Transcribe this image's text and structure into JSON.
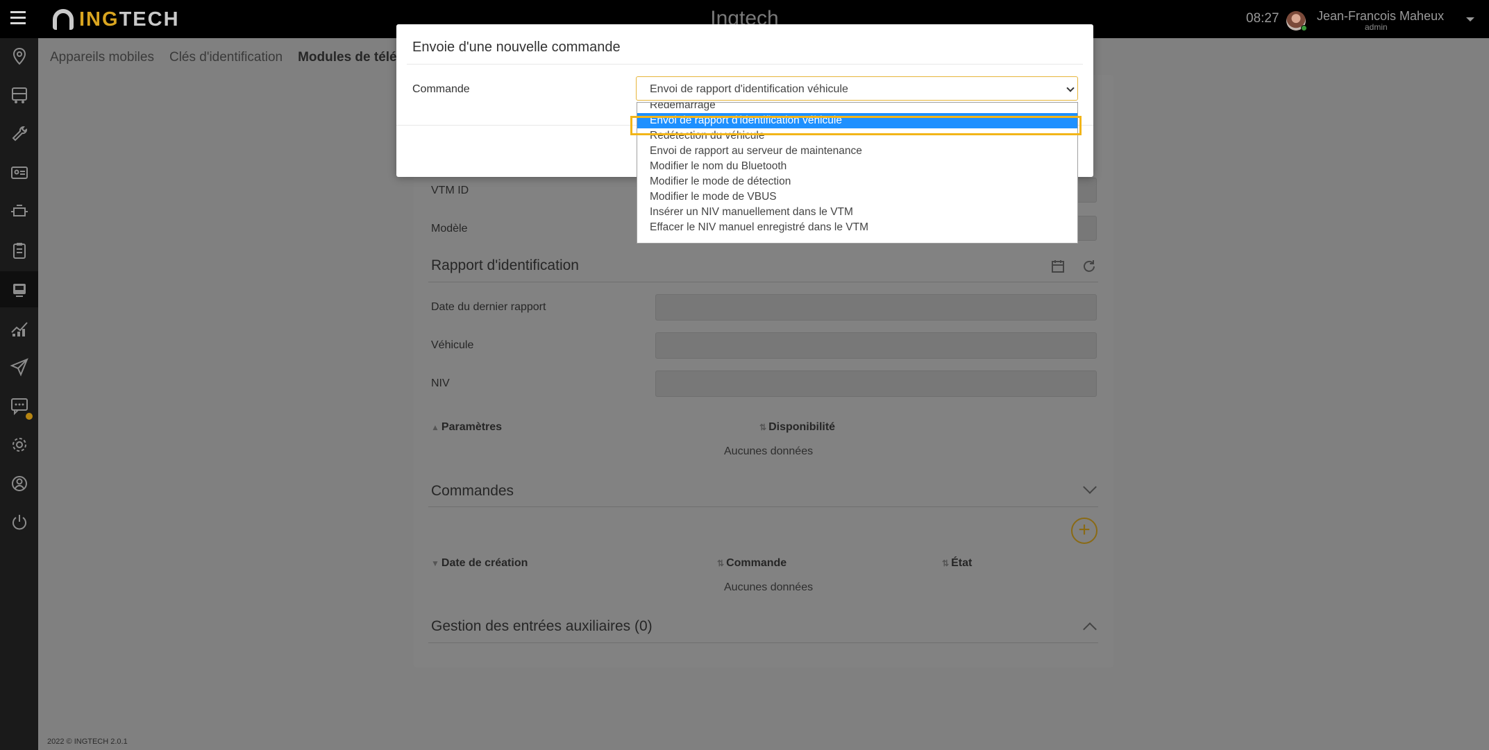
{
  "topbar": {
    "logo_text_accent": "ING",
    "logo_text_rest": "TECH",
    "app_title": "Ingtech",
    "time": "08:27",
    "user_name": "Jean-Francois Maheux",
    "user_role": "admin"
  },
  "sidebar": {
    "items": [
      {
        "icon": "map-pin-icon"
      },
      {
        "icon": "truck-icon"
      },
      {
        "icon": "wrench-icon"
      },
      {
        "icon": "id-card-icon"
      },
      {
        "icon": "engine-icon"
      },
      {
        "icon": "clipboard-icon"
      },
      {
        "icon": "device-icon",
        "active": true
      },
      {
        "icon": "chart-icon"
      },
      {
        "icon": "send-icon"
      },
      {
        "icon": "message-icon",
        "notification": true
      },
      {
        "icon": "gear-icon"
      },
      {
        "icon": "support-icon"
      },
      {
        "icon": "power-icon"
      }
    ]
  },
  "tabs": [
    "Appareils mobiles",
    "Clés d'identification",
    "Modules de télé"
  ],
  "card": {
    "vtm_id_label": "VTM ID",
    "modele_label": "Modèle",
    "rapport_title": "Rapport d'identification",
    "date_label": "Date du dernier rapport",
    "vehicule_label": "Véhicule",
    "niv_label": "NIV",
    "params_header": "Paramètres",
    "dispo_header": "Disponibilité",
    "no_data_1": "Aucunes données",
    "commandes_title": "Commandes",
    "date_creation_header": "Date de création",
    "commande_header": "Commande",
    "etat_header": "État",
    "no_data_2": "Aucunes données",
    "aux_title": "Gestion des entrées auxiliaires (0)"
  },
  "footer": "2022 © INGTECH 2.0.1",
  "modal": {
    "title": "Envoie d'une nouvelle commande",
    "field_label": "Commande",
    "selected_value": "Envoi de rapport d'identification véhicule",
    "options": [
      "Redémarrage",
      "Envoi de rapport d'identification véhicule",
      "Redétection du véhicule",
      "Envoi de rapport au serveur de maintenance",
      "Modifier le nom du Bluetooth",
      "Modifier le mode de détection",
      "Modifier le mode de VBUS",
      "Insérer un NIV manuellement dans le VTM",
      "Effacer le NIV manuel enregistré dans le VTM"
    ],
    "selected_index": 1
  },
  "colors": {
    "accent": "#d9a520",
    "highlight": "#f2b518",
    "selected_option": "#1e90ff"
  }
}
